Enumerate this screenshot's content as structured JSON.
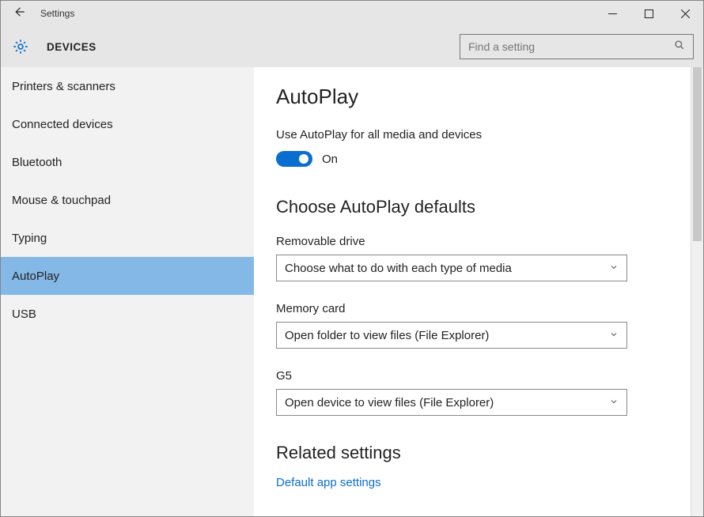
{
  "titlebar": {
    "title": "Settings"
  },
  "header": {
    "section": "DEVICES",
    "search_placeholder": "Find a setting"
  },
  "sidebar": {
    "items": [
      {
        "label": "Printers & scanners"
      },
      {
        "label": "Connected devices"
      },
      {
        "label": "Bluetooth"
      },
      {
        "label": "Mouse & touchpad"
      },
      {
        "label": "Typing"
      },
      {
        "label": "AutoPlay"
      },
      {
        "label": "USB"
      }
    ],
    "active_index": 5
  },
  "main": {
    "title": "AutoPlay",
    "toggle_label": "Use AutoPlay for all media and devices",
    "toggle_state": "On",
    "defaults_heading": "Choose AutoPlay defaults",
    "fields": [
      {
        "label": "Removable drive",
        "value": "Choose what to do with each type of media"
      },
      {
        "label": "Memory card",
        "value": "Open folder to view files (File Explorer)"
      },
      {
        "label": "G5",
        "value": "Open device to view files (File Explorer)"
      }
    ],
    "related_heading": "Related settings",
    "related_link": "Default app settings"
  }
}
